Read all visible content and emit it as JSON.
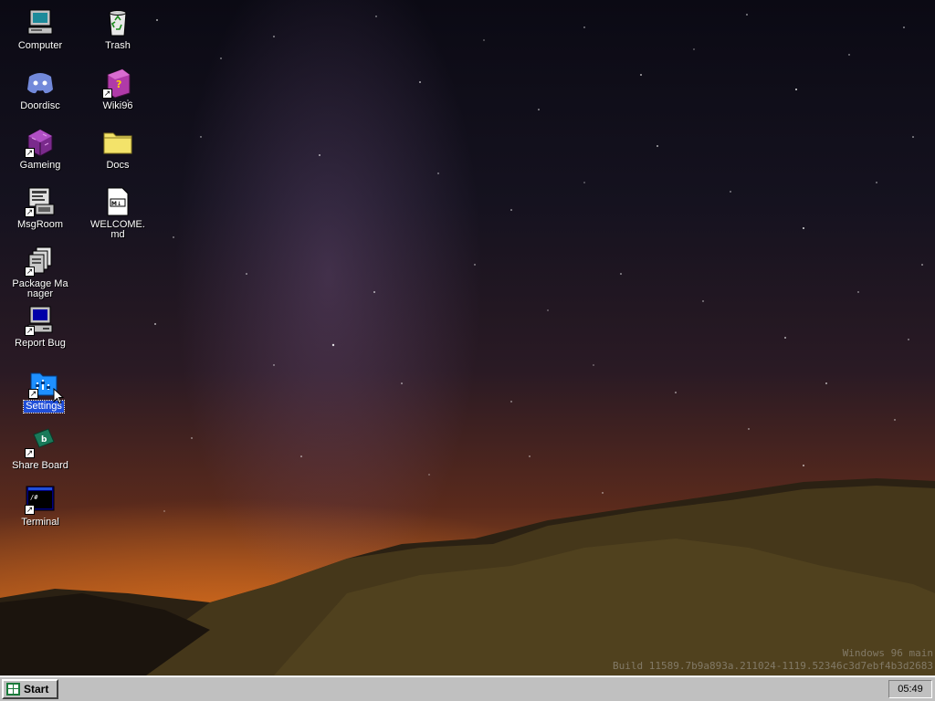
{
  "desktop": {
    "icons": [
      {
        "label": "Computer",
        "icon": "computer-icon",
        "shortcut": false,
        "selected": false
      },
      {
        "label": "Trash",
        "icon": "recycle-bin-icon",
        "shortcut": false,
        "selected": false
      },
      {
        "label": "Doordisc",
        "icon": "discord-icon",
        "shortcut": false,
        "selected": false
      },
      {
        "label": "Wiki96",
        "icon": "help-book-icon",
        "shortcut": true,
        "selected": false
      },
      {
        "label": "Gameing",
        "icon": "game-cube-icon",
        "shortcut": true,
        "selected": false
      },
      {
        "label": "Docs",
        "icon": "folder-icon",
        "shortcut": false,
        "selected": false
      },
      {
        "label": "MsgRoom",
        "icon": "chat-computer-icon",
        "shortcut": true,
        "selected": false
      },
      {
        "label": "WELCOME.md",
        "icon": "markdown-file-icon",
        "shortcut": false,
        "selected": false
      },
      {
        "label": "Package Manager",
        "icon": "package-manager-icon",
        "shortcut": true,
        "selected": false
      },
      {
        "label": "Report Bug",
        "icon": "bug-report-computer-icon",
        "shortcut": true,
        "selected": false
      },
      {
        "label": "Settings",
        "icon": "settings-folder-icon",
        "shortcut": true,
        "selected": true
      },
      {
        "label": "Share Board",
        "icon": "share-board-icon",
        "shortcut": true,
        "selected": false
      },
      {
        "label": "Terminal",
        "icon": "terminal-icon",
        "shortcut": true,
        "selected": false
      }
    ],
    "watermark": {
      "line1": "Windows 96 main",
      "line2": "Build 11589.7b9a893a.211024-1119.52346c3d7ebf4b3d2683"
    }
  },
  "taskbar": {
    "start_label": "Start",
    "clock": "05:49"
  },
  "colors": {
    "taskbar": "#c0c0c0",
    "selection": "#1f4ed8"
  }
}
